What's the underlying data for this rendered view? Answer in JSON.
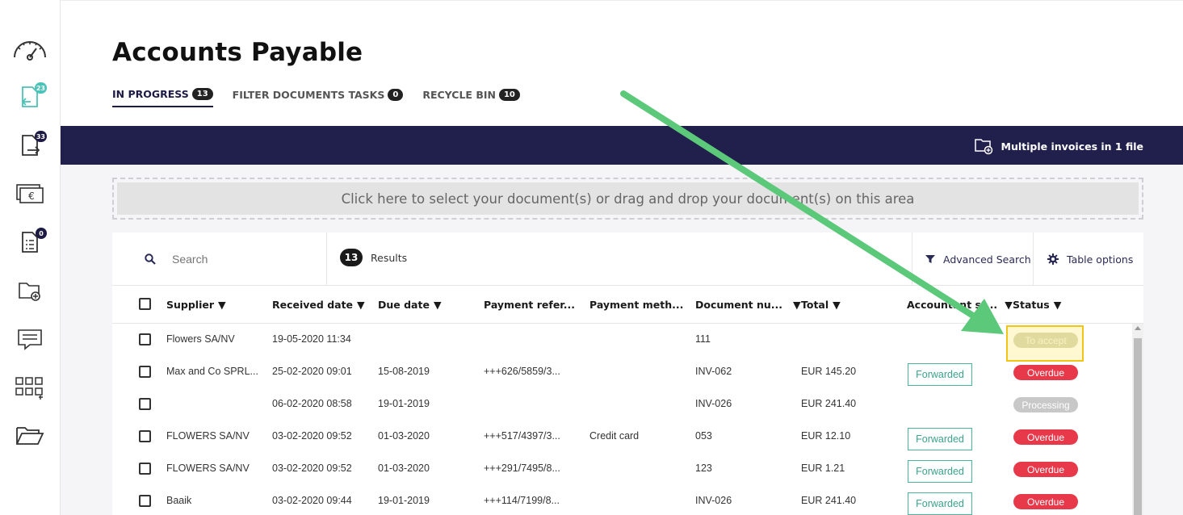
{
  "sidebar": {
    "items": [
      {
        "icon": "dashboard-gauge-icon"
      },
      {
        "icon": "incoming-documents-icon",
        "badge": "23"
      },
      {
        "icon": "outgoing-documents-icon",
        "badge": "33"
      },
      {
        "icon": "euro-payment-icon"
      },
      {
        "icon": "task-list-icon",
        "badge": "0"
      },
      {
        "icon": "folder-add-icon"
      },
      {
        "icon": "messages-icon"
      },
      {
        "icon": "apps-grid-icon"
      },
      {
        "icon": "open-folder-icon"
      }
    ]
  },
  "header": {
    "title": "Accounts Payable",
    "tabs": [
      {
        "label": "IN PROGRESS",
        "count": "13"
      },
      {
        "label": "FILTER DOCUMENTS TASKS",
        "count": "0"
      },
      {
        "label": "RECYCLE BIN",
        "count": "10"
      }
    ]
  },
  "banner": {
    "link_label": "Multiple invoices in 1 file"
  },
  "dropzone": {
    "text": "Click here to select your document(s) or drag and drop your document(s) on this area"
  },
  "toolbar": {
    "search_placeholder": "Search",
    "results_count": "13",
    "results_label": "Results",
    "advanced_search": "Advanced Search",
    "table_options": "Table options"
  },
  "table": {
    "columns": [
      "Supplier",
      "Received date",
      "Due date",
      "Payment refer...",
      "Payment meth...",
      "Document nu...",
      "Total",
      "Accountant st...",
      "Status"
    ],
    "rows": [
      {
        "supplier": "Flowers SA/NV",
        "received": "19-05-2020 11:34",
        "due": "",
        "payref": "",
        "paymeth": "",
        "docnum": "111",
        "total": "",
        "accountant": "",
        "status": "To accept",
        "status_type": "accept"
      },
      {
        "supplier": "Max and Co SPRL...",
        "received": "25-02-2020 09:01",
        "due": "15-08-2019",
        "payref": "+++626/5859/3...",
        "paymeth": "",
        "docnum": "INV-062",
        "total": "EUR 145.20",
        "accountant": "Forwarded",
        "status": "Overdue",
        "status_type": "overdue"
      },
      {
        "supplier": "",
        "received": "06-02-2020 08:58",
        "due": "19-01-2019",
        "payref": "",
        "paymeth": "",
        "docnum": "INV-026",
        "total": "EUR 241.40",
        "accountant": "",
        "status": "Processing",
        "status_type": "processing"
      },
      {
        "supplier": "FLOWERS SA/NV",
        "received": "03-02-2020 09:52",
        "due": "01-03-2020",
        "payref": "+++517/4397/3...",
        "paymeth": "Credit card",
        "docnum": "053",
        "total": "EUR 12.10",
        "accountant": "Forwarded",
        "status": "Overdue",
        "status_type": "overdue"
      },
      {
        "supplier": "FLOWERS SA/NV",
        "received": "03-02-2020 09:52",
        "due": "01-03-2020",
        "payref": "+++291/7495/8...",
        "paymeth": "",
        "docnum": "123",
        "total": "EUR 1.21",
        "accountant": "Forwarded",
        "status": "Overdue",
        "status_type": "overdue"
      },
      {
        "supplier": "Baaik",
        "received": "03-02-2020 09:44",
        "due": "19-01-2019",
        "payref": "+++114/7199/8...",
        "paymeth": "",
        "docnum": "INV-026",
        "total": "EUR 241.40",
        "accountant": "Forwarded",
        "status": "Overdue",
        "status_type": "overdue"
      }
    ]
  },
  "colors": {
    "navy": "#211f4c",
    "overdue": "#e8394a",
    "forwarded": "#3aa38c",
    "arrow": "#5cc87a",
    "highlight": "#f0c419"
  }
}
